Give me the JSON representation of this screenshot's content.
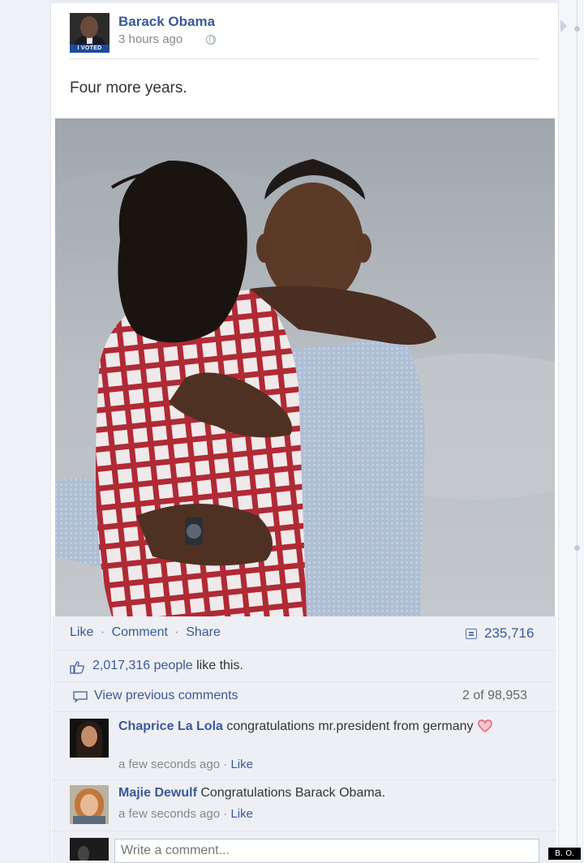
{
  "post": {
    "author": "Barack Obama",
    "timestamp": "3 hours ago",
    "avatar_badge": "I VOTED",
    "status_text": "Four more years."
  },
  "actions": {
    "like": "Like",
    "comment": "Comment",
    "share": "Share",
    "separator": "·",
    "share_count": "235,716"
  },
  "likes": {
    "count": "2,017,316 people",
    "suffix": " like this."
  },
  "comments_header": {
    "view_previous": "View previous comments",
    "count": "2 of 98,953"
  },
  "comments": [
    {
      "name": "Chaprice La Lola",
      "text": " congratulations mr.president from germany",
      "time": "a few seconds ago",
      "like": "Like"
    },
    {
      "name": "Majie Dewulf",
      "text": " Congratulations Barack Obama.",
      "time": "a few seconds ago",
      "like": "Like"
    }
  ],
  "composer": {
    "placeholder": "Write a comment..."
  },
  "watermark": "B. O.",
  "icons": [
    "globe-icon",
    "share-count-icon",
    "thumbs-up-icon",
    "comment-bubble-icon",
    "heart-icon",
    "collapse-arrow-icon"
  ],
  "colors": {
    "link": "#3b5998",
    "footer_bg": "#edeff4",
    "page_bg": "#eceff5"
  }
}
